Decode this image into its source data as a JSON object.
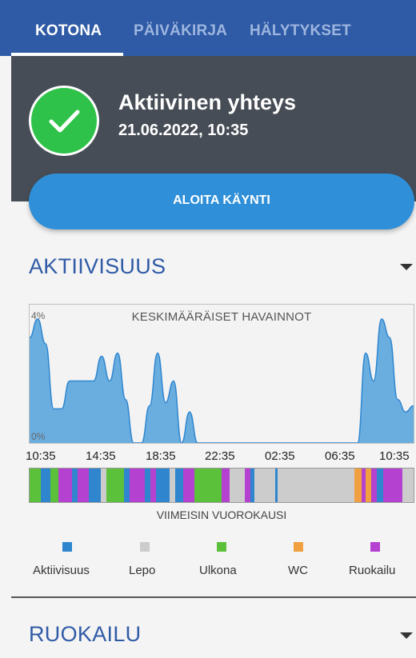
{
  "tabs": [
    {
      "label": "KOTONA",
      "active": true
    },
    {
      "label": "PÄIVÄKIRJA",
      "active": false
    },
    {
      "label": "HÄLYTYKSET",
      "active": false
    }
  ],
  "status": {
    "title": "Aktiivinen yhteys",
    "timestamp": "21.06.2022, 10:35",
    "icon": "check-icon",
    "color": "#2fc24a"
  },
  "visit_button": {
    "label": "ALOITA KÄYNTI"
  },
  "activity_section": {
    "title": "AKTIIVISUUS"
  },
  "meals_section": {
    "title": "RUOKAILU"
  },
  "chart_data": {
    "type": "area",
    "title": "KESKIMÄÄRÄISET HAVAINNOT",
    "y_tick_labels": [
      "4%",
      "0%"
    ],
    "ylim": [
      0,
      4
    ],
    "x_tick_labels": [
      "10:35",
      "14:35",
      "18:35",
      "22:35",
      "02:35",
      "06:35",
      "10:35"
    ],
    "x_hours": [
      0,
      0.5,
      1,
      1.5,
      2,
      2.5,
      3,
      3.5,
      4,
      4.5,
      5,
      5.5,
      6,
      6.5,
      7,
      7.5,
      8,
      8.5,
      9,
      9.5,
      10,
      10.5,
      11,
      11.5,
      12,
      12.5,
      13,
      13.5,
      14,
      14.5,
      15,
      15.5,
      16,
      16.5,
      17,
      17.5,
      18,
      18.5,
      19,
      19.5,
      20,
      20.5,
      21,
      21.5,
      22,
      22.5,
      23,
      23.5,
      24
    ],
    "values": [
      3.4,
      4.0,
      3.2,
      1.1,
      1.1,
      2.0,
      2.0,
      2.0,
      2.0,
      2.8,
      2.0,
      2.9,
      1.4,
      0.0,
      0.0,
      1.2,
      2.9,
      1.3,
      2.0,
      0.0,
      1.0,
      0.0,
      0.0,
      0.0,
      0.0,
      0.0,
      0.0,
      0.0,
      0.0,
      0.0,
      0.0,
      0.0,
      0.0,
      0.0,
      0.0,
      0.0,
      0.0,
      0.0,
      0.0,
      0.0,
      0.0,
      0.0,
      2.9,
      2.0,
      4.0,
      3.4,
      1.4,
      1.0,
      1.2
    ],
    "fill_color": "#6aaee0",
    "line_color": "#2f86cf",
    "grid": false
  },
  "timeline": {
    "caption": "VIIMEISIN VUOROKAUSI",
    "segments": [
      {
        "start": 0.0,
        "end": 0.03,
        "category": "Ulkona"
      },
      {
        "start": 0.03,
        "end": 0.055,
        "category": "Aktiivisuus"
      },
      {
        "start": 0.055,
        "end": 0.075,
        "category": "Ulkona"
      },
      {
        "start": 0.075,
        "end": 0.11,
        "category": "Ruokailu"
      },
      {
        "start": 0.11,
        "end": 0.125,
        "category": "Aktiivisuus"
      },
      {
        "start": 0.125,
        "end": 0.155,
        "category": "Ruokailu"
      },
      {
        "start": 0.155,
        "end": 0.185,
        "category": "Aktiivisuus"
      },
      {
        "start": 0.185,
        "end": 0.2,
        "category": "Lepo"
      },
      {
        "start": 0.2,
        "end": 0.245,
        "category": "Ulkona"
      },
      {
        "start": 0.245,
        "end": 0.26,
        "category": "Aktiivisuus"
      },
      {
        "start": 0.26,
        "end": 0.3,
        "category": "Ruokailu"
      },
      {
        "start": 0.3,
        "end": 0.315,
        "category": "Aktiivisuus"
      },
      {
        "start": 0.315,
        "end": 0.33,
        "category": "Ruokailu"
      },
      {
        "start": 0.33,
        "end": 0.365,
        "category": "Aktiivisuus"
      },
      {
        "start": 0.365,
        "end": 0.38,
        "category": "Lepo"
      },
      {
        "start": 0.38,
        "end": 0.4,
        "category": "Aktiivisuus"
      },
      {
        "start": 0.4,
        "end": 0.43,
        "category": "Ruokailu"
      },
      {
        "start": 0.43,
        "end": 0.5,
        "category": "Ulkona"
      },
      {
        "start": 0.5,
        "end": 0.52,
        "category": "Ruokailu"
      },
      {
        "start": 0.52,
        "end": 0.56,
        "category": "Lepo"
      },
      {
        "start": 0.56,
        "end": 0.575,
        "category": "Ruokailu"
      },
      {
        "start": 0.575,
        "end": 0.585,
        "category": "Aktiivisuus"
      },
      {
        "start": 0.585,
        "end": 0.64,
        "category": "Lepo"
      },
      {
        "start": 0.64,
        "end": 0.645,
        "category": "Aktiivisuus"
      },
      {
        "start": 0.645,
        "end": 0.845,
        "category": "Lepo"
      },
      {
        "start": 0.845,
        "end": 0.865,
        "category": "WC"
      },
      {
        "start": 0.865,
        "end": 0.875,
        "category": "Ruokailu"
      },
      {
        "start": 0.875,
        "end": 0.89,
        "category": "WC"
      },
      {
        "start": 0.89,
        "end": 0.905,
        "category": "Ruokailu"
      },
      {
        "start": 0.905,
        "end": 0.92,
        "category": "Aktiivisuus"
      },
      {
        "start": 0.92,
        "end": 0.97,
        "category": "Ruokailu"
      },
      {
        "start": 0.97,
        "end": 1.0,
        "category": "Lepo"
      }
    ]
  },
  "legend": [
    {
      "label": "Aktiivisuus",
      "color": "#2f86cf"
    },
    {
      "label": "Lepo",
      "color": "#cccccc"
    },
    {
      "label": "Ulkona",
      "color": "#5cc13a"
    },
    {
      "label": "WC",
      "color": "#f0a040"
    },
    {
      "label": "Ruokailu",
      "color": "#b541d0"
    }
  ]
}
